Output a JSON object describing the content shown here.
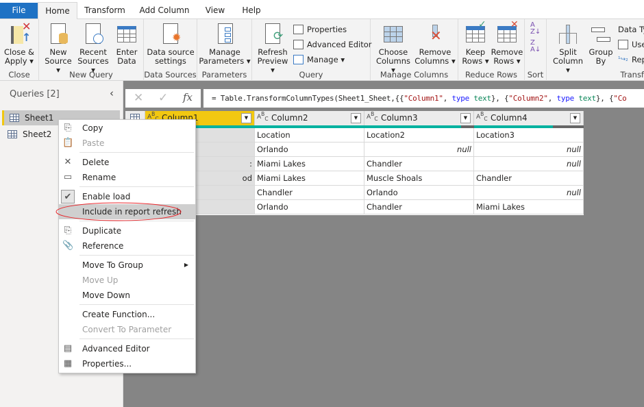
{
  "tabs": [
    "File",
    "Home",
    "Transform",
    "Add Column",
    "View",
    "Help"
  ],
  "ribbon": {
    "groups": [
      "Close",
      "New Query",
      "Data Sources",
      "Parameters",
      "Query",
      "Manage Columns",
      "Reduce Rows",
      "Sort",
      "Transf"
    ],
    "close_apply": [
      "Close &",
      "Apply ▾"
    ],
    "new_source": [
      "New",
      "Source ▾"
    ],
    "recent_sources": [
      "Recent",
      "Sources ▾"
    ],
    "enter_data": [
      "Enter",
      "Data"
    ],
    "data_source_settings": [
      "Data source",
      "settings"
    ],
    "manage_parameters": [
      "Manage",
      "Parameters ▾"
    ],
    "refresh_preview": [
      "Refresh",
      "Preview ▾"
    ],
    "properties": "Properties",
    "advanced_editor": "Advanced Editor",
    "manage": "Manage ▾",
    "choose_columns": [
      "Choose",
      "Columns ▾"
    ],
    "remove_columns": [
      "Remove",
      "Columns ▾"
    ],
    "keep_rows": [
      "Keep",
      "Rows ▾"
    ],
    "remove_rows": [
      "Remove",
      "Rows ▾"
    ],
    "split_column": [
      "Split",
      "Column ▾"
    ],
    "group_by": [
      "Group",
      "By"
    ],
    "data_type": "Data Typ",
    "use_first_row": "Use",
    "replace_values": "Rep"
  },
  "queries": {
    "title": "Queries [2]",
    "items": [
      "Sheet1",
      "Sheet2"
    ]
  },
  "formula": {
    "prefix": "= Table.TransformColumnTypes(Sheet1_Sheet,{{",
    "c1": "\"Column1\"",
    "sep1": ", ",
    "kw1": "type",
    "ty1": " text",
    "close1": "}, {",
    "c2": "\"Column2\"",
    "sep2": ", ",
    "kw2": "type",
    "ty2": " text",
    "close2": "}, {",
    "c3": "\"Co"
  },
  "grid": {
    "type_icon": "ABC",
    "columns": [
      "Column1",
      "Column2",
      "Column3",
      "Column4"
    ],
    "rows": [
      [
        "",
        "Location",
        "Location2",
        "Location3"
      ],
      [
        "",
        "Orlando",
        "null",
        "null"
      ],
      [
        ":",
        "Miami Lakes",
        "Chandler",
        "null"
      ],
      [
        "od",
        "Miami Lakes",
        "Muscle Shoals",
        "Chandler"
      ],
      [
        "",
        "Chandler",
        "Orlando",
        "null"
      ],
      [
        "",
        "Orlando",
        "Chandler",
        "Miami Lakes"
      ]
    ],
    "quality": [
      1,
      1,
      0.88,
      0.72
    ]
  },
  "context_menu": [
    {
      "label": "Copy",
      "icon": "copy-icon",
      "disabled": false
    },
    {
      "label": "Paste",
      "icon": "paste-icon",
      "disabled": true
    },
    {
      "sep": true
    },
    {
      "label": "Delete",
      "icon": "delete-icon",
      "disabled": false
    },
    {
      "label": "Rename",
      "icon": "rename-icon",
      "disabled": false
    },
    {
      "sep": true
    },
    {
      "label": "Enable load",
      "icon": "check-icon",
      "disabled": false,
      "checked": true
    },
    {
      "label": "Include in report refresh",
      "disabled": false,
      "highlighted": true
    },
    {
      "sep": true
    },
    {
      "label": "Duplicate",
      "icon": "duplicate-icon",
      "disabled": false
    },
    {
      "label": "Reference",
      "icon": "reference-icon",
      "disabled": false
    },
    {
      "sep": true
    },
    {
      "label": "Move To Group",
      "disabled": false,
      "submenu": true
    },
    {
      "label": "Move Up",
      "disabled": true
    },
    {
      "label": "Move Down",
      "disabled": false
    },
    {
      "sep": true
    },
    {
      "label": "Create Function...",
      "disabled": false
    },
    {
      "label": "Convert To Parameter",
      "disabled": true
    },
    {
      "sep": true
    },
    {
      "label": "Advanced Editor",
      "icon": "advanced-editor-icon",
      "disabled": false
    },
    {
      "label": "Properties...",
      "icon": "properties-icon",
      "disabled": false
    }
  ],
  "colors": {
    "file_tab": "#1f72c4",
    "selected_header": "#f2c811",
    "quality_bar": "#00b2a0",
    "annotation": "#e8262b"
  }
}
